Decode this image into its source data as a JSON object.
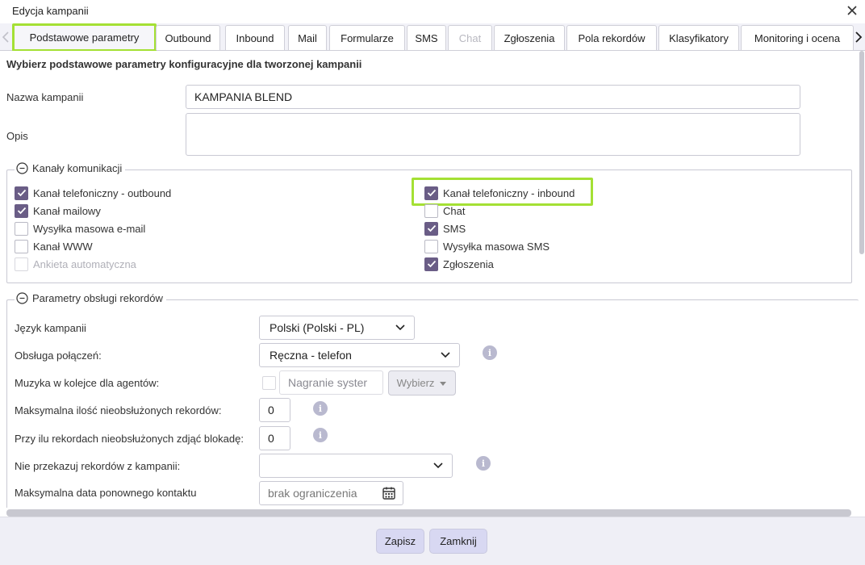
{
  "window": {
    "title": "Edycja kampanii"
  },
  "tabs": [
    {
      "label": "Podstawowe parametry",
      "state": "active"
    },
    {
      "label": "Outbound",
      "state": "normal"
    },
    {
      "label": "Inbound",
      "state": "normal"
    },
    {
      "label": "Mail",
      "state": "normal"
    },
    {
      "label": "Formularze",
      "state": "normal"
    },
    {
      "label": "SMS",
      "state": "normal"
    },
    {
      "label": "Chat",
      "state": "disabled"
    },
    {
      "label": "Zgłoszenia",
      "state": "normal"
    },
    {
      "label": "Pola rekordów",
      "state": "normal"
    },
    {
      "label": "Klasyfikatory",
      "state": "normal"
    },
    {
      "label": "Monitoring i ocena",
      "state": "normal"
    }
  ],
  "intro": "Wybierz podstawowe parametry konfiguracyjne dla tworzonej kampanii",
  "basic": {
    "name_label": "Nazwa kampanii",
    "name_value": "KAMPANIA BLEND",
    "desc_label": "Opis",
    "desc_value": ""
  },
  "channels": {
    "legend": "Kanały komunikacji",
    "left": [
      {
        "label": "Kanał telefoniczny - outbound",
        "checked": true,
        "disabled": false
      },
      {
        "label": "Kanał mailowy",
        "checked": true,
        "disabled": false
      },
      {
        "label": "Wysyłka masowa e-mail",
        "checked": false,
        "disabled": false
      },
      {
        "label": "Kanał WWW",
        "checked": false,
        "disabled": false
      },
      {
        "label": "Ankieta automatyczna",
        "checked": false,
        "disabled": true
      }
    ],
    "right": [
      {
        "label": "Kanał telefoniczny - inbound",
        "checked": true,
        "disabled": false
      },
      {
        "label": "Chat",
        "checked": false,
        "disabled": false
      },
      {
        "label": "SMS",
        "checked": true,
        "disabled": false
      },
      {
        "label": "Wysyłka masowa SMS",
        "checked": false,
        "disabled": false
      },
      {
        "label": "Zgłoszenia",
        "checked": true,
        "disabled": false
      }
    ]
  },
  "records": {
    "legend": "Parametry obsługi rekordów",
    "language_label": "Język kampanii",
    "language_value": "Polski (Polski - PL)",
    "calls_label": "Obsługa połączeń:",
    "calls_value": "Ręczna - telefon",
    "music_label": "Muzyka w kolejce dla agentów:",
    "music_placeholder": "Nagranie syster",
    "music_button": "Wybierz",
    "max_unhandled_label": "Maksymalna ilość nieobsłużonych rekordów:",
    "max_unhandled_value": "0",
    "unlock_label": "Przy ilu rekordach nieobsłużonych zdjąć blokadę:",
    "unlock_value": "0",
    "no_transfer_label": "Nie przekazuj rekordów z kampanii:",
    "no_transfer_value": "",
    "max_date_label": "Maksymalna data ponownego kontaktu",
    "max_date_placeholder": "brak ograniczenia"
  },
  "footer": {
    "save": "Zapisz",
    "close": "Zamknij"
  },
  "colors": {
    "accent_highlight": "#a4e034",
    "checkbox_checked": "#6a5d86",
    "button_bg": "#d8d8f2"
  }
}
